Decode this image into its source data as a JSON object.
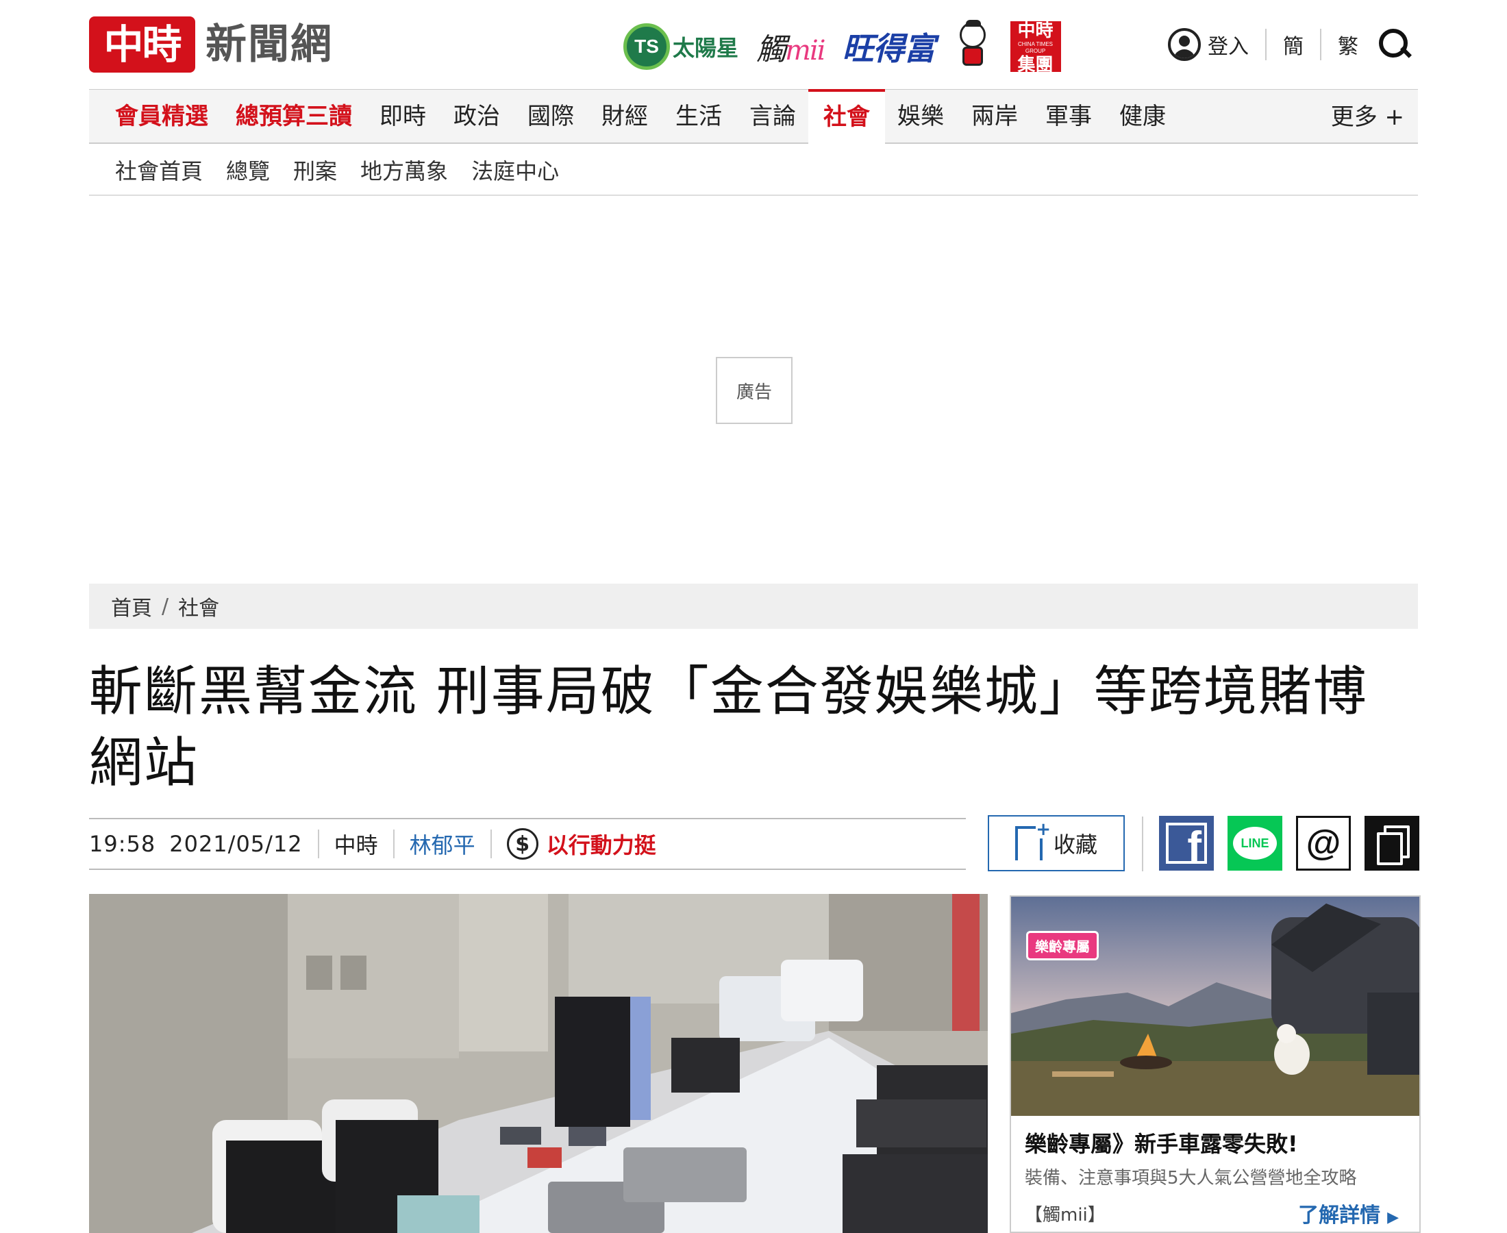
{
  "header": {
    "logo_red": "中時",
    "logo_text": "新聞網",
    "brands": {
      "taiyang_badge": "TS",
      "taiyang": "太陽星",
      "mii_text": "觸",
      "mii_suffix": "mii",
      "want": "旺得富",
      "group_top": "中時",
      "group_small": "CHINA TIMES GROUP",
      "group_bottom": "集團"
    },
    "login": "登入",
    "lang_simplified": "簡",
    "lang_traditional": "繁"
  },
  "main_nav": {
    "items": [
      "會員精選",
      "總預算三讀",
      "即時",
      "政治",
      "國際",
      "財經",
      "生活",
      "言論",
      "社會",
      "娛樂",
      "兩岸",
      "軍事",
      "健康"
    ],
    "active": "社會",
    "more": "更多 +"
  },
  "sub_nav": {
    "items": [
      "社會首頁",
      "總覽",
      "刑案",
      "地方萬象",
      "法庭中心"
    ]
  },
  "ad": {
    "label": "廣告"
  },
  "breadcrumb": {
    "home": "首頁",
    "separator": "/",
    "current": "社會"
  },
  "article": {
    "title": "斬斷黑幫金流 刑事局破「金合發娛樂城」等跨境賭博網站",
    "time": "19:58",
    "date": "2021/05/12",
    "source": "中時",
    "author": "林郁平",
    "support_symbol": "$",
    "support": "以行動力挺",
    "save": "收藏"
  },
  "share": {
    "facebook": "f",
    "line": "LINE",
    "threads": "@"
  },
  "sidebar_card": {
    "badge": "樂齡專屬",
    "title": "樂齡專屬》新手車露零失敗!",
    "desc": "裝備、注意事項與5大人氣公營營地全攻略",
    "source": "【觸mii】",
    "more": "了解詳情"
  },
  "colors": {
    "brand_red": "#d3111b",
    "link_blue": "#2468b0",
    "facebook": "#3b5998",
    "line": "#06c755"
  }
}
